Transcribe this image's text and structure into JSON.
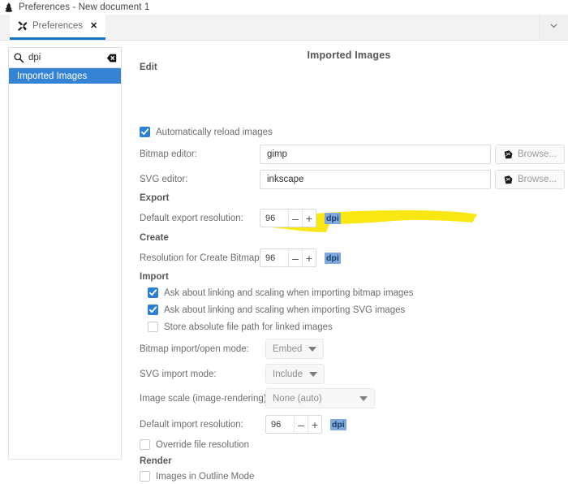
{
  "window": {
    "title": "Preferences - New document 1",
    "app_icon": "inkscape-logo-icon"
  },
  "tabbar": {
    "tab_label": "Preferences",
    "tab_icon": "tools-icon",
    "close_icon": "close-icon",
    "overflow_icon": "chevron-down-icon",
    "accent_color": "#1a73c8"
  },
  "sidebar": {
    "search": {
      "value": "dpi",
      "placeholder": "Search",
      "icon": "search-icon",
      "clear_icon": "clear-icon"
    },
    "items": [
      {
        "label": "Imported Images",
        "selected": true
      }
    ],
    "selection_color": "#3483d4"
  },
  "main": {
    "page_title": "Imported Images",
    "groups": {
      "edit": "Edit",
      "export": "Export",
      "create": "Create",
      "import": "Import",
      "render": "Render"
    },
    "auto_reload": {
      "label": "Automatically reload images",
      "checked": true
    },
    "bitmap_editor": {
      "label": "Bitmap editor:",
      "value": "gimp",
      "browse_label": "Browse...",
      "browse_icon": "browse-icon"
    },
    "svg_editor": {
      "label": "SVG editor:",
      "value": "inkscape",
      "browse_label": "Browse...",
      "browse_icon": "browse-icon"
    },
    "default_export_resolution": {
      "label": "Default export resolution:",
      "value": "96",
      "unit": "dpi",
      "minus": "–",
      "plus": "+",
      "highlighted": true
    },
    "create_bitmap_resolution": {
      "label": "Resolution for Create Bitmap Copy:",
      "value": "96",
      "unit": "dpi",
      "minus": "–",
      "plus": "+"
    },
    "ask_bitmap": {
      "label": "Ask about linking and scaling when importing bitmap images",
      "checked": true
    },
    "ask_svg": {
      "label": "Ask about linking and scaling when importing SVG images",
      "checked": true
    },
    "store_abs_path": {
      "label": "Store absolute file path for linked images",
      "checked": false
    },
    "bitmap_import_mode": {
      "label": "Bitmap import/open mode:",
      "value": "Embed"
    },
    "svg_import_mode": {
      "label": "SVG import mode:",
      "value": "Include"
    },
    "image_scale": {
      "label": "Image scale (image-rendering):",
      "value": "None (auto)"
    },
    "default_import_resolution": {
      "label": "Default import resolution:",
      "value": "96",
      "unit": "dpi",
      "minus": "–",
      "plus": "+"
    },
    "override_file_resolution": {
      "label": "Override file resolution",
      "checked": false
    },
    "images_outline_mode": {
      "label": "Images in Outline Mode",
      "checked": false
    },
    "highlight_color": "#f5e400"
  }
}
